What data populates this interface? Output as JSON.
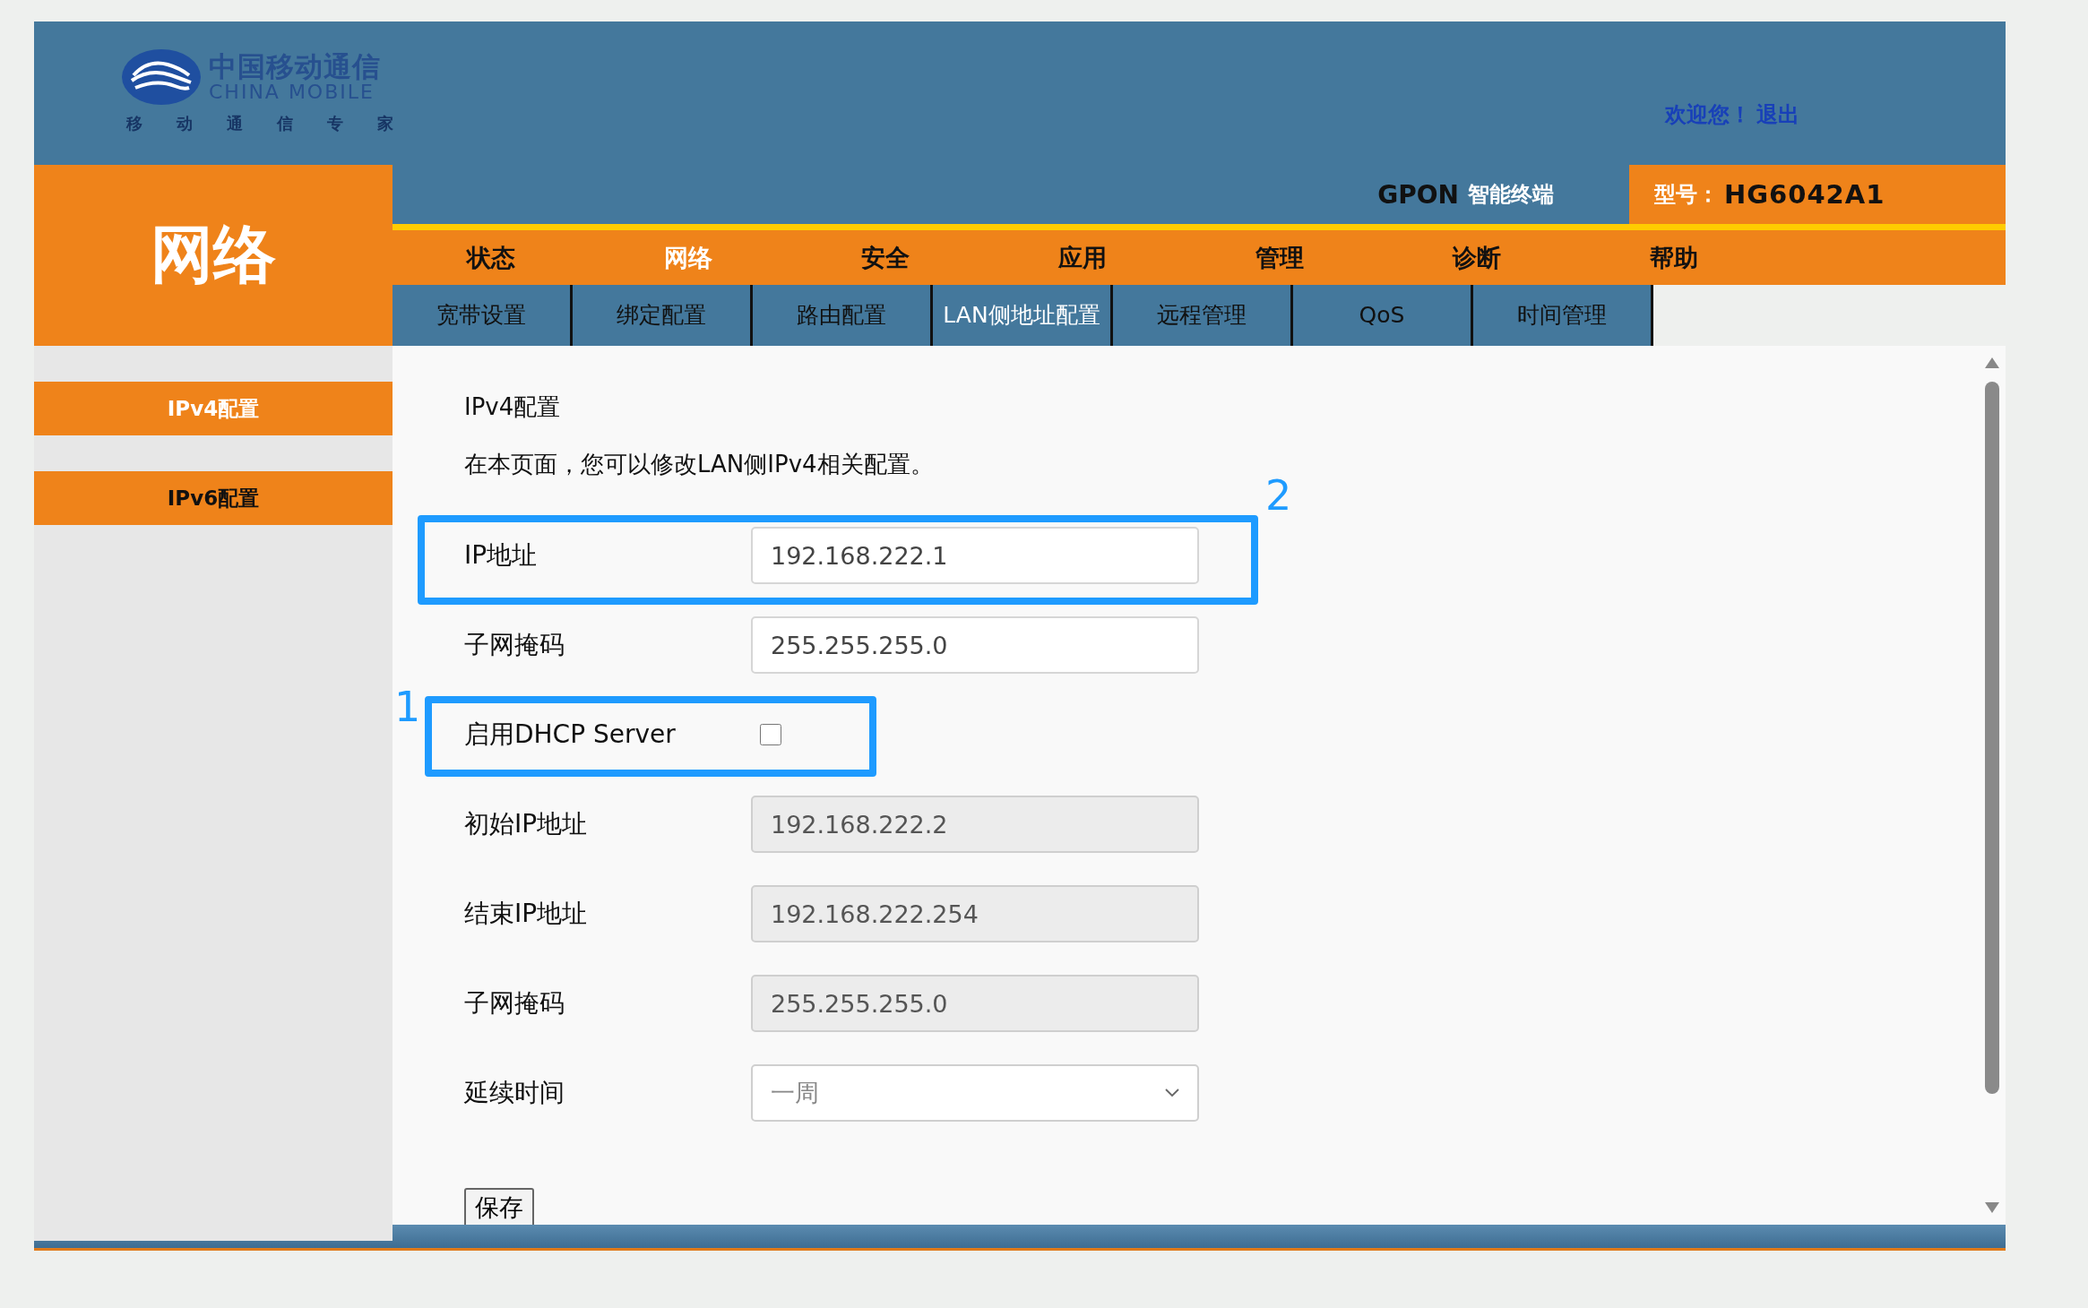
{
  "logo": {
    "name_cn": "中国移动通信",
    "name_en": "CHINA MOBILE",
    "slogan": [
      "移",
      "动",
      "通",
      "信",
      "专",
      "家"
    ]
  },
  "header": {
    "welcome": "欢迎您！",
    "logout": "退出",
    "product": "GPON",
    "product_suffix": "智能终端",
    "model_label": "型号：",
    "model": "HG6042A1"
  },
  "section_title": "网络",
  "nav": [
    {
      "label": "状态",
      "selected": false
    },
    {
      "label": "网络",
      "selected": true
    },
    {
      "label": "安全",
      "selected": false
    },
    {
      "label": "应用",
      "selected": false
    },
    {
      "label": "管理",
      "selected": false
    },
    {
      "label": "诊断",
      "selected": false
    },
    {
      "label": "帮助",
      "selected": false
    }
  ],
  "subnav": [
    {
      "label": "宽带设置",
      "selected": false
    },
    {
      "label": "绑定配置",
      "selected": false
    },
    {
      "label": "路由配置",
      "selected": false
    },
    {
      "label": "LAN侧地址配置",
      "selected": true
    },
    {
      "label": "远程管理",
      "selected": false
    },
    {
      "label": "QoS",
      "selected": false
    },
    {
      "label": "时间管理",
      "selected": false
    }
  ],
  "sidebar": {
    "items": [
      {
        "label": "IPv4配置",
        "selected": true
      },
      {
        "label": "IPv6配置",
        "selected": false
      }
    ]
  },
  "content": {
    "title": "IPv4配置",
    "description": "在本页面，您可以修改LAN侧IPv4相关配置。",
    "fields": [
      {
        "kind": "input",
        "label": "IP地址",
        "value": "192.168.222.1",
        "disabled": false,
        "annotation": "2"
      },
      {
        "kind": "input",
        "label": "子网掩码",
        "value": "255.255.255.0",
        "disabled": false
      },
      {
        "kind": "checkbox",
        "label": "启用DHCP Server",
        "checked": false,
        "annotation": "1"
      },
      {
        "kind": "input",
        "label": "初始IP地址",
        "value": "192.168.222.2",
        "disabled": true
      },
      {
        "kind": "input",
        "label": "结束IP地址",
        "value": "192.168.222.254",
        "disabled": true
      },
      {
        "kind": "input",
        "label": "子网掩码",
        "value": "255.255.255.0",
        "disabled": true
      },
      {
        "kind": "select",
        "label": "延续时间",
        "value": "一周",
        "disabled": true
      }
    ],
    "save_button": "保存"
  }
}
